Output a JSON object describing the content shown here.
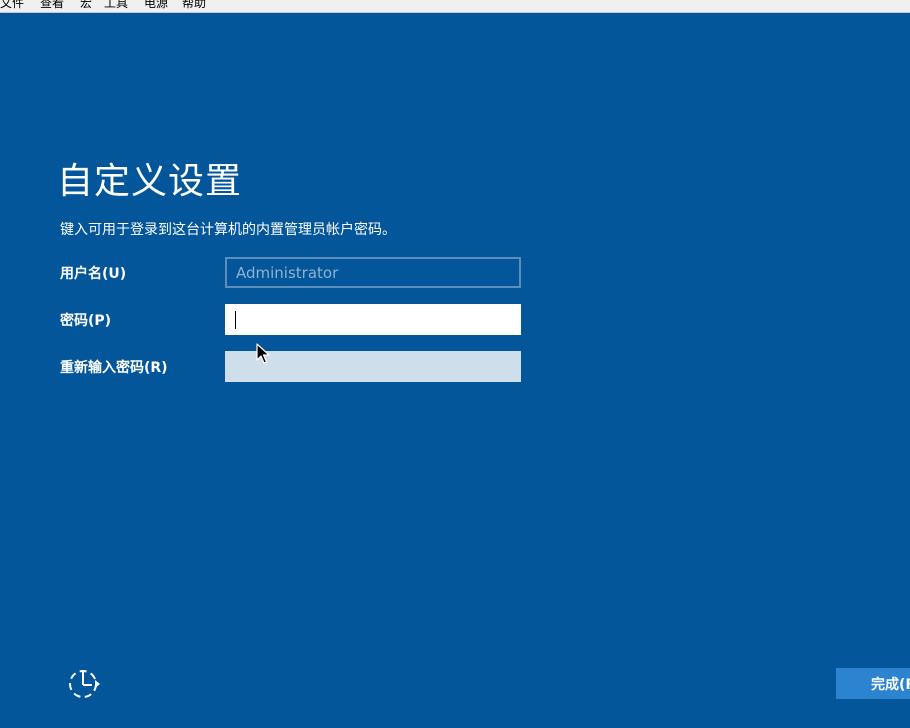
{
  "menubar": {
    "items": [
      "文件",
      "查看",
      "宏",
      "工具",
      "电源",
      "帮助"
    ]
  },
  "title": "自定义设置",
  "description": "键入可用于登录到这台计算机的内置管理员帐户密码。",
  "fields": {
    "username_label": "用户名(U)",
    "username_value": "Administrator",
    "password_label": "密码(P)",
    "password_value": "",
    "confirm_label": "重新输入密码(R)",
    "confirm_value": ""
  },
  "icons": {
    "ease_of_access": "ease-of-access-icon",
    "mouse_pointer": "mouse-pointer-icon"
  },
  "colors": {
    "background": "#03569a",
    "button": "#2c83d0",
    "disabled_field": "#cfdeeb"
  },
  "buttons": {
    "finish_label": "完成(F)"
  }
}
